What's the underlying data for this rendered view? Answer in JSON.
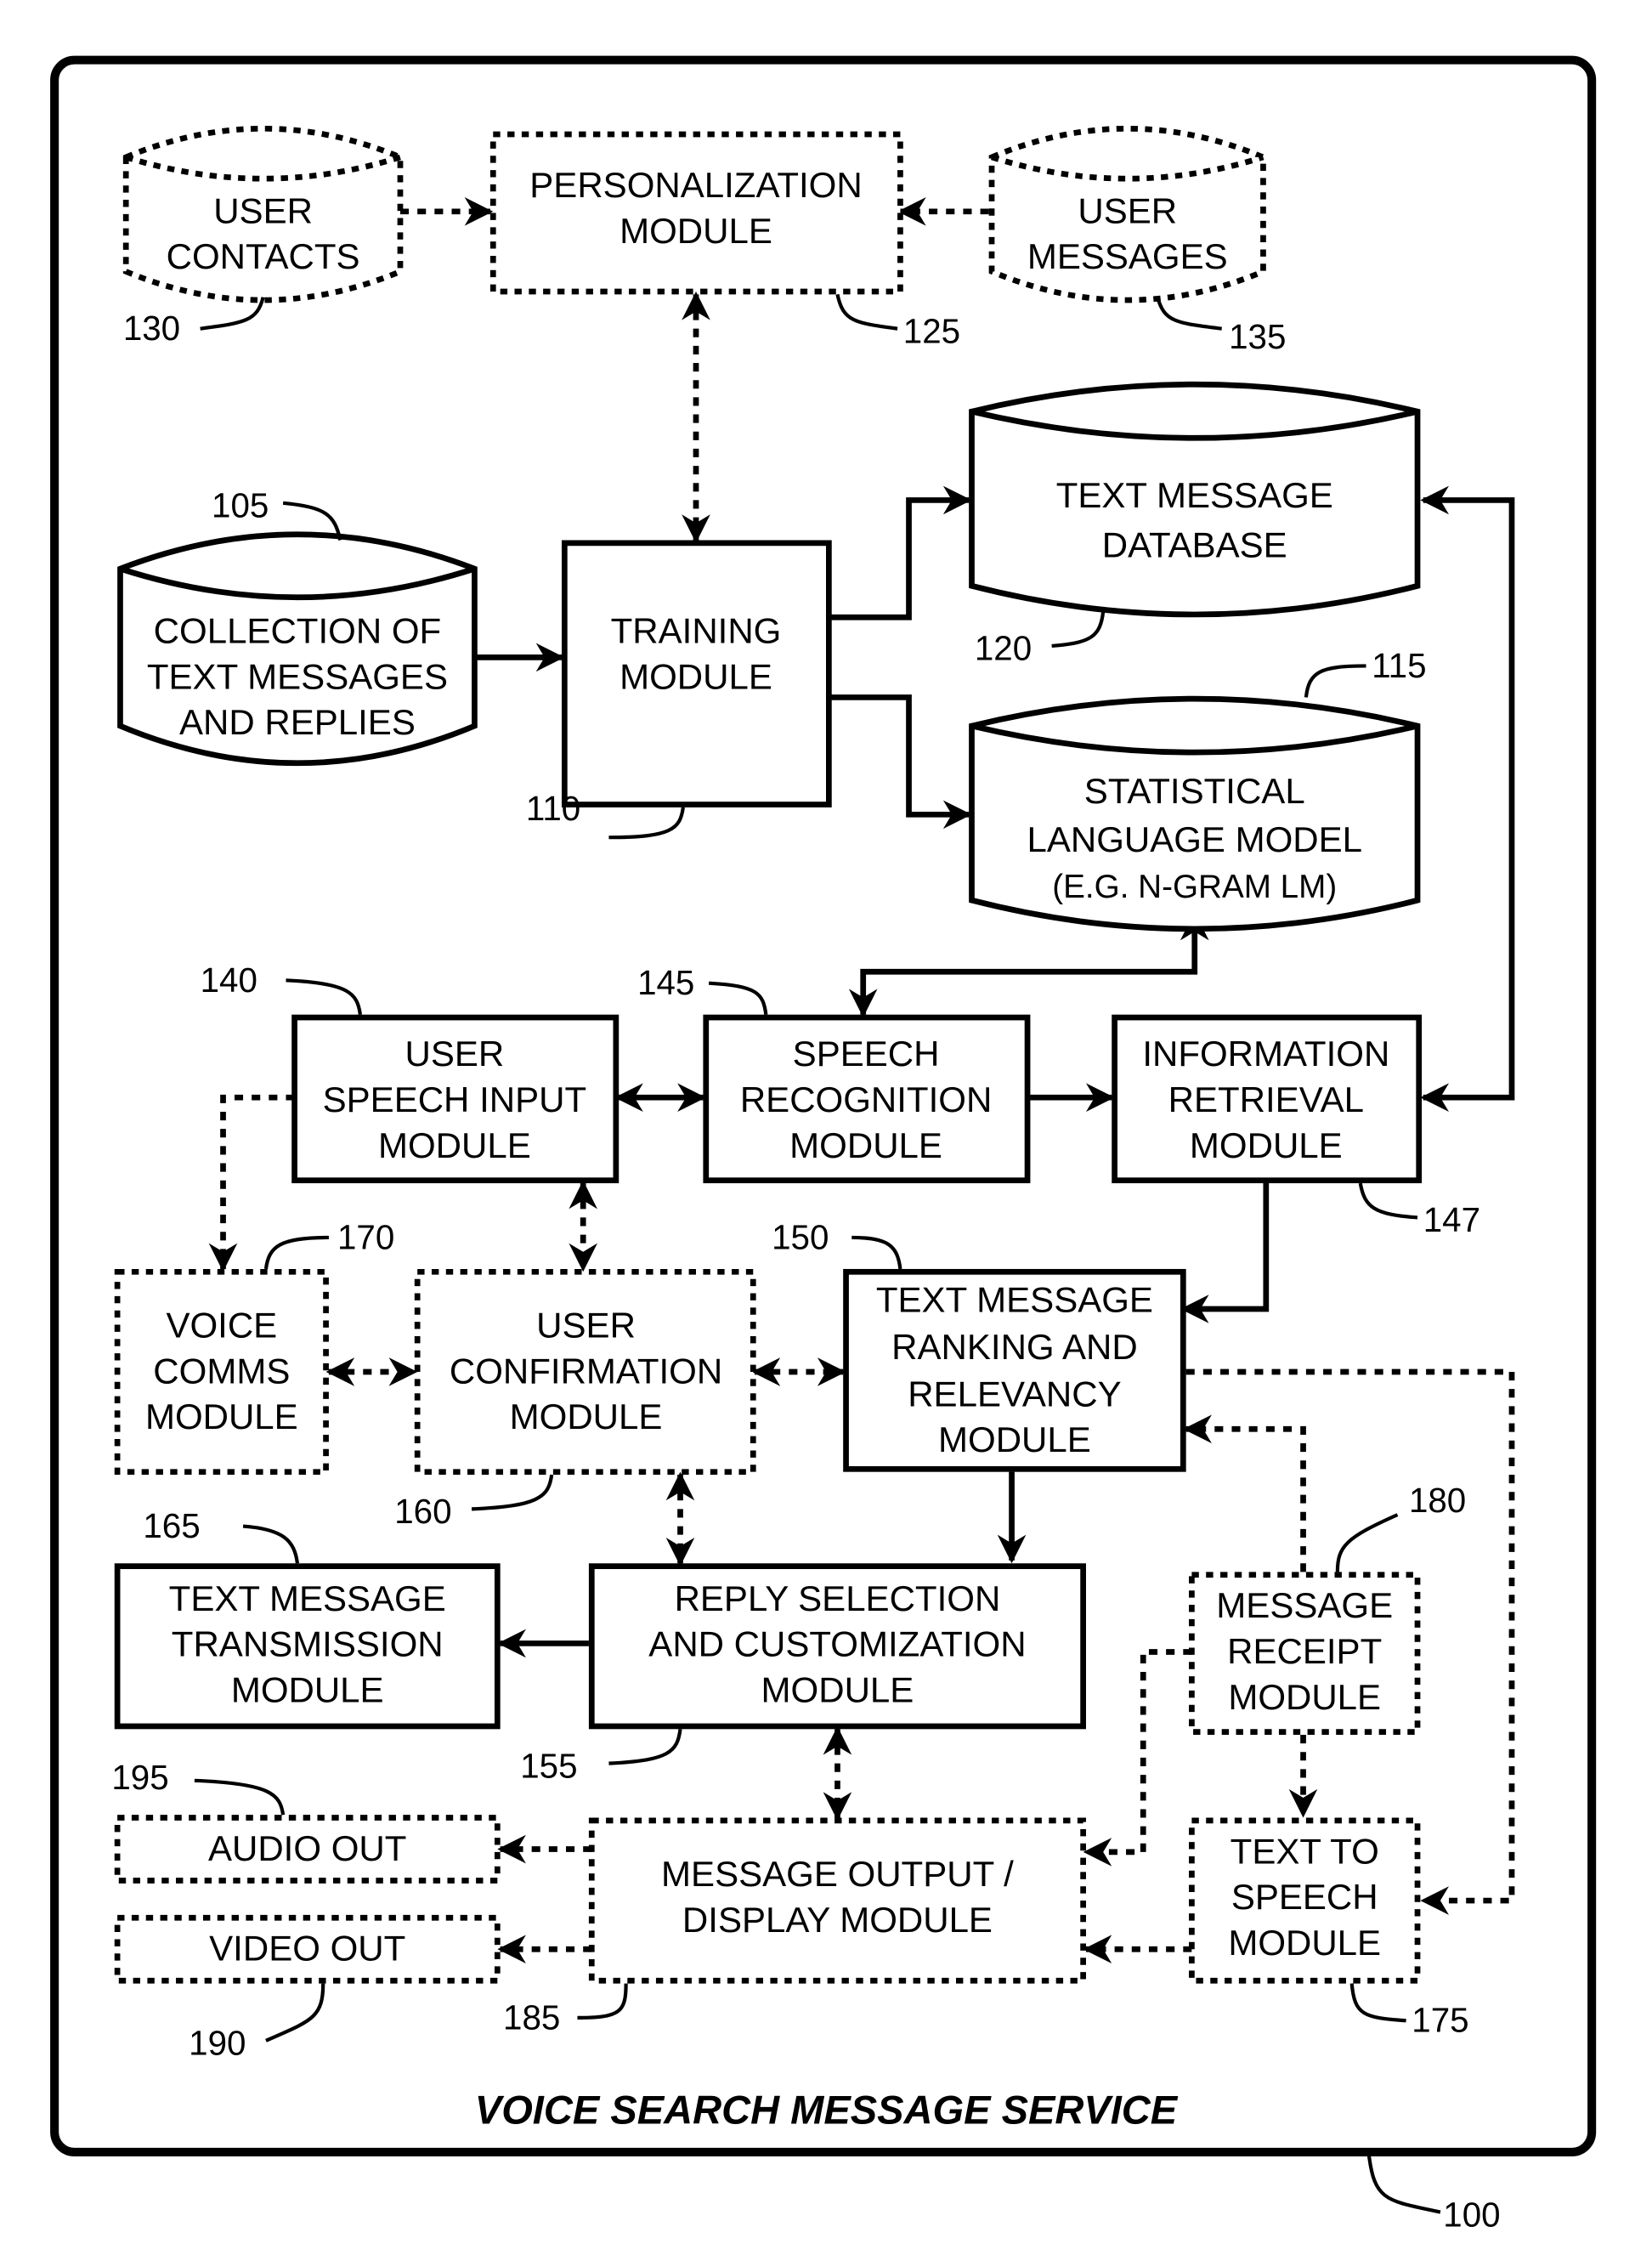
{
  "title": "VOICE SEARCH MESSAGE SERVICE",
  "system_ref": "100",
  "nodes": {
    "user_contacts": {
      "lines": [
        "USER",
        "CONTACTS"
      ],
      "ref": "130",
      "shape": "database",
      "style": "dashed"
    },
    "personalization": {
      "lines": [
        "PERSONALIZATION",
        "MODULE"
      ],
      "ref": "125",
      "shape": "box",
      "style": "dashed"
    },
    "user_messages": {
      "lines": [
        "USER",
        "MESSAGES"
      ],
      "ref": "135",
      "shape": "database",
      "style": "dashed"
    },
    "collection": {
      "lines": [
        "COLLECTION OF",
        "TEXT MESSAGES",
        "AND REPLIES"
      ],
      "ref": "105",
      "shape": "database",
      "style": "solid"
    },
    "training": {
      "lines": [
        "TRAINING",
        "MODULE"
      ],
      "ref": "110",
      "shape": "box",
      "style": "solid"
    },
    "text_db": {
      "lines": [
        "TEXT MESSAGE",
        "DATABASE"
      ],
      "ref": "120",
      "shape": "database",
      "style": "solid"
    },
    "slm": {
      "lines": [
        "STATISTICAL",
        "LANGUAGE MODEL",
        "(E.G. N-GRAM LM)"
      ],
      "ref": "115",
      "shape": "database",
      "style": "solid"
    },
    "speech_input": {
      "lines": [
        "USER",
        "SPEECH INPUT",
        "MODULE"
      ],
      "ref": "140",
      "shape": "box",
      "style": "solid"
    },
    "speech_recog": {
      "lines": [
        "SPEECH",
        "RECOGNITION",
        "MODULE"
      ],
      "ref": "145",
      "shape": "box",
      "style": "solid"
    },
    "info_retrieval": {
      "lines": [
        "INFORMATION",
        "RETRIEVAL",
        "MODULE"
      ],
      "ref": "147",
      "shape": "box",
      "style": "solid"
    },
    "voice_comms": {
      "lines": [
        "VOICE",
        "COMMS",
        "MODULE"
      ],
      "ref": "170",
      "shape": "box",
      "style": "dashed"
    },
    "user_confirm": {
      "lines": [
        "USER",
        "CONFIRMATION",
        "MODULE"
      ],
      "ref": "160",
      "shape": "box",
      "style": "dashed"
    },
    "ranking": {
      "lines": [
        "TEXT MESSAGE",
        "RANKING AND",
        "RELEVANCY",
        "MODULE"
      ],
      "ref": "150",
      "shape": "box",
      "style": "solid"
    },
    "transmission": {
      "lines": [
        "TEXT MESSAGE",
        "TRANSMISSION",
        "MODULE"
      ],
      "ref": "165",
      "shape": "box",
      "style": "solid"
    },
    "reply_select": {
      "lines": [
        "REPLY SELECTION",
        "AND CUSTOMIZATION",
        "MODULE"
      ],
      "ref": "155",
      "shape": "box",
      "style": "solid"
    },
    "msg_receipt": {
      "lines": [
        "MESSAGE",
        "RECEIPT",
        "MODULE"
      ],
      "ref": "180",
      "shape": "box",
      "style": "dashed"
    },
    "audio_out": {
      "lines": [
        "AUDIO OUT"
      ],
      "ref": "195",
      "shape": "box",
      "style": "dashed"
    },
    "video_out": {
      "lines": [
        "VIDEO OUT"
      ],
      "ref": "190",
      "shape": "box",
      "style": "dashed"
    },
    "msg_output": {
      "lines": [
        "MESSAGE OUTPUT /",
        "DISPLAY MODULE"
      ],
      "ref": "185",
      "shape": "box",
      "style": "dashed"
    },
    "tts": {
      "lines": [
        "TEXT TO",
        "SPEECH",
        "MODULE"
      ],
      "ref": "175",
      "shape": "box",
      "style": "dashed"
    }
  },
  "edges": [
    {
      "from": "user_contacts",
      "to": "personalization",
      "style": "dashed",
      "direction": "forward"
    },
    {
      "from": "user_messages",
      "to": "personalization",
      "style": "dashed",
      "direction": "forward"
    },
    {
      "from": "personalization",
      "to": "training",
      "style": "dashed",
      "direction": "both"
    },
    {
      "from": "collection",
      "to": "training",
      "style": "solid",
      "direction": "forward"
    },
    {
      "from": "training",
      "to": "text_db",
      "style": "solid",
      "direction": "forward"
    },
    {
      "from": "training",
      "to": "slm",
      "style": "solid",
      "direction": "forward"
    },
    {
      "from": "slm",
      "to": "speech_recog",
      "style": "solid",
      "direction": "both"
    },
    {
      "from": "text_db",
      "to": "info_retrieval",
      "style": "solid",
      "direction": "both"
    },
    {
      "from": "speech_input",
      "to": "speech_recog",
      "style": "solid",
      "direction": "both"
    },
    {
      "from": "speech_recog",
      "to": "info_retrieval",
      "style": "solid",
      "direction": "forward"
    },
    {
      "from": "info_retrieval",
      "to": "ranking",
      "style": "solid",
      "direction": "forward"
    },
    {
      "from": "speech_input",
      "to": "voice_comms",
      "style": "dashed",
      "direction": "forward"
    },
    {
      "from": "speech_input",
      "to": "user_confirm",
      "style": "dashed",
      "direction": "both"
    },
    {
      "from": "voice_comms",
      "to": "user_confirm",
      "style": "dashed",
      "direction": "both"
    },
    {
      "from": "user_confirm",
      "to": "ranking",
      "style": "dashed",
      "direction": "both"
    },
    {
      "from": "user_confirm",
      "to": "reply_select",
      "style": "dashed",
      "direction": "both"
    },
    {
      "from": "ranking",
      "to": "reply_select",
      "style": "solid",
      "direction": "forward"
    },
    {
      "from": "ranking",
      "to": "tts",
      "style": "dashed",
      "direction": "forward"
    },
    {
      "from": "msg_receipt",
      "to": "ranking",
      "style": "dashed",
      "direction": "forward"
    },
    {
      "from": "reply_select",
      "to": "transmission",
      "style": "solid",
      "direction": "forward"
    },
    {
      "from": "reply_select",
      "to": "msg_output",
      "style": "dashed",
      "direction": "both"
    },
    {
      "from": "msg_receipt",
      "to": "msg_output",
      "style": "dashed",
      "direction": "forward"
    },
    {
      "from": "msg_receipt",
      "to": "tts",
      "style": "dashed",
      "direction": "forward"
    },
    {
      "from": "msg_output",
      "to": "audio_out",
      "style": "dashed",
      "direction": "forward"
    },
    {
      "from": "msg_output",
      "to": "video_out",
      "style": "dashed",
      "direction": "forward"
    },
    {
      "from": "tts",
      "to": "msg_output",
      "style": "dashed",
      "direction": "forward"
    }
  ]
}
